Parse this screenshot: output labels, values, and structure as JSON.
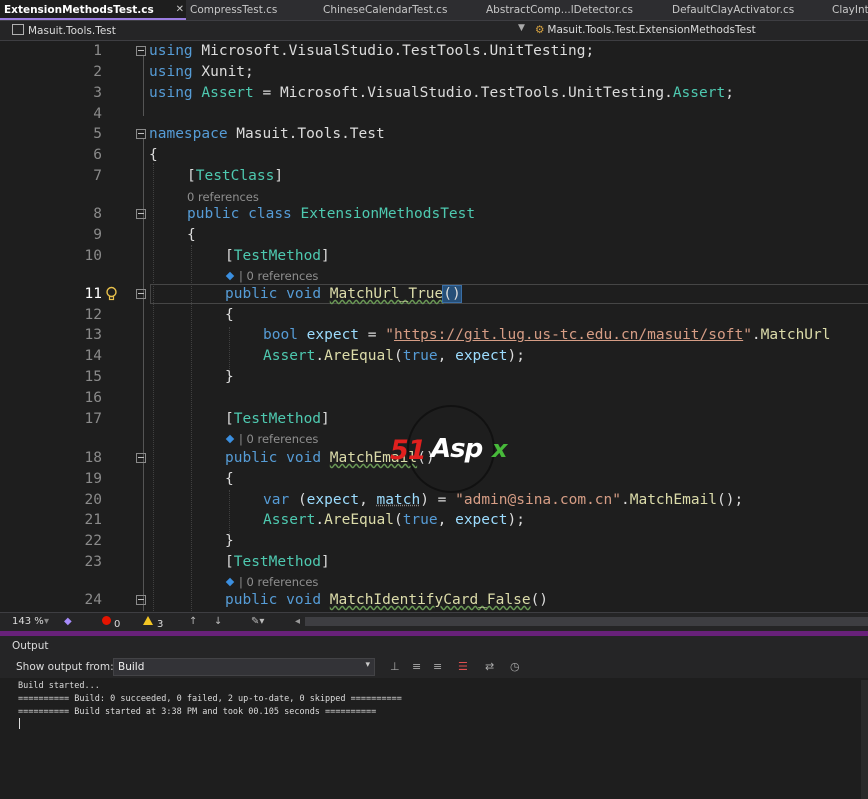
{
  "tabs": [
    {
      "label": "ExtensionMethodsTest.cs",
      "active": true,
      "close": "✕"
    },
    {
      "label": "CompressTest.cs"
    },
    {
      "label": "ChineseCalendarTest.cs"
    },
    {
      "label": "AbstractComp...lDetector.cs"
    },
    {
      "label": "DefaultClayActivator.cs"
    },
    {
      "label": "ClayInt"
    }
  ],
  "nav": {
    "project": "Masuit.Tools.Test",
    "member": "Masuit.Tools.Test.ExtensionMethodsTest"
  },
  "lines": [
    {
      "n": "1"
    },
    {
      "n": "2"
    },
    {
      "n": "3"
    },
    {
      "n": "4"
    },
    {
      "n": "5"
    },
    {
      "n": "6"
    },
    {
      "n": "7"
    },
    {
      "n": "8"
    },
    {
      "n": "9"
    },
    {
      "n": "10"
    },
    {
      "n": "11"
    },
    {
      "n": "12"
    },
    {
      "n": "13"
    },
    {
      "n": "14"
    },
    {
      "n": "15"
    },
    {
      "n": "16"
    },
    {
      "n": "17"
    },
    {
      "n": "18"
    },
    {
      "n": "19"
    },
    {
      "n": "20"
    },
    {
      "n": "21"
    },
    {
      "n": "22"
    },
    {
      "n": "23"
    },
    {
      "n": "24"
    }
  ],
  "code": {
    "l1a": "using",
    "l1b": " Microsoft.VisualStudio.TestTools.UnitTesting;",
    "l2a": "using",
    "l2b": " Xunit;",
    "l3a": "using",
    "l3b": "Assert",
    "l3c": " = Microsoft.VisualStudio.TestTools.UnitTesting.",
    "l3d": "Assert",
    "l3e": ";",
    "l5a": "namespace",
    "l5b": " Masuit.Tools.Test",
    "brace_open": "{",
    "brace_close": "}",
    "attr_open": "[",
    "attr_close": "]",
    "testclass": "TestClass",
    "testmethod": "TestMethod",
    "l8a": "public",
    "l8b": "class",
    "l8c": "ExtensionMethodsTest",
    "public": "public",
    "void": "void",
    "m1": "MatchUrl_True",
    "parens": "()",
    "bool": "bool",
    "expect": "expect",
    "eq": " = ",
    "url": "https://git.lug.us-tc.edu.cn/masuit/soft",
    "quote": "\"",
    "dot": ".",
    "matchurl": "MatchUrl",
    "assert": "Assert",
    "areequal": "AreEqual",
    "true": "true",
    "comma": ", ",
    "close_stmt": ");",
    "open_paren": "(",
    "m2": "MatchEmail",
    "var": "var",
    "match": "match",
    "email_str": "\"admin@sina.com.cn\"",
    "matchemail": "MatchEmail",
    "call_end": "();",
    "m3": "MatchIdentifyCard_False"
  },
  "lens": {
    "refs": "0 references"
  },
  "watermark": {
    "brand_51": "51",
    "brand_asp": "Asp",
    "brand_x": "x"
  },
  "status": {
    "zoom": "143 %",
    "errors": "0",
    "warnings": "3"
  },
  "output": {
    "title": "Output",
    "show_from": "Show output from:",
    "source": "Build",
    "log": "Build started...\n========== Build: 0 succeeded, 0 failed, 2 up-to-date, 0 skipped ==========\n========== Build started at 3:38 PM and took 00.105 seconds =========="
  }
}
